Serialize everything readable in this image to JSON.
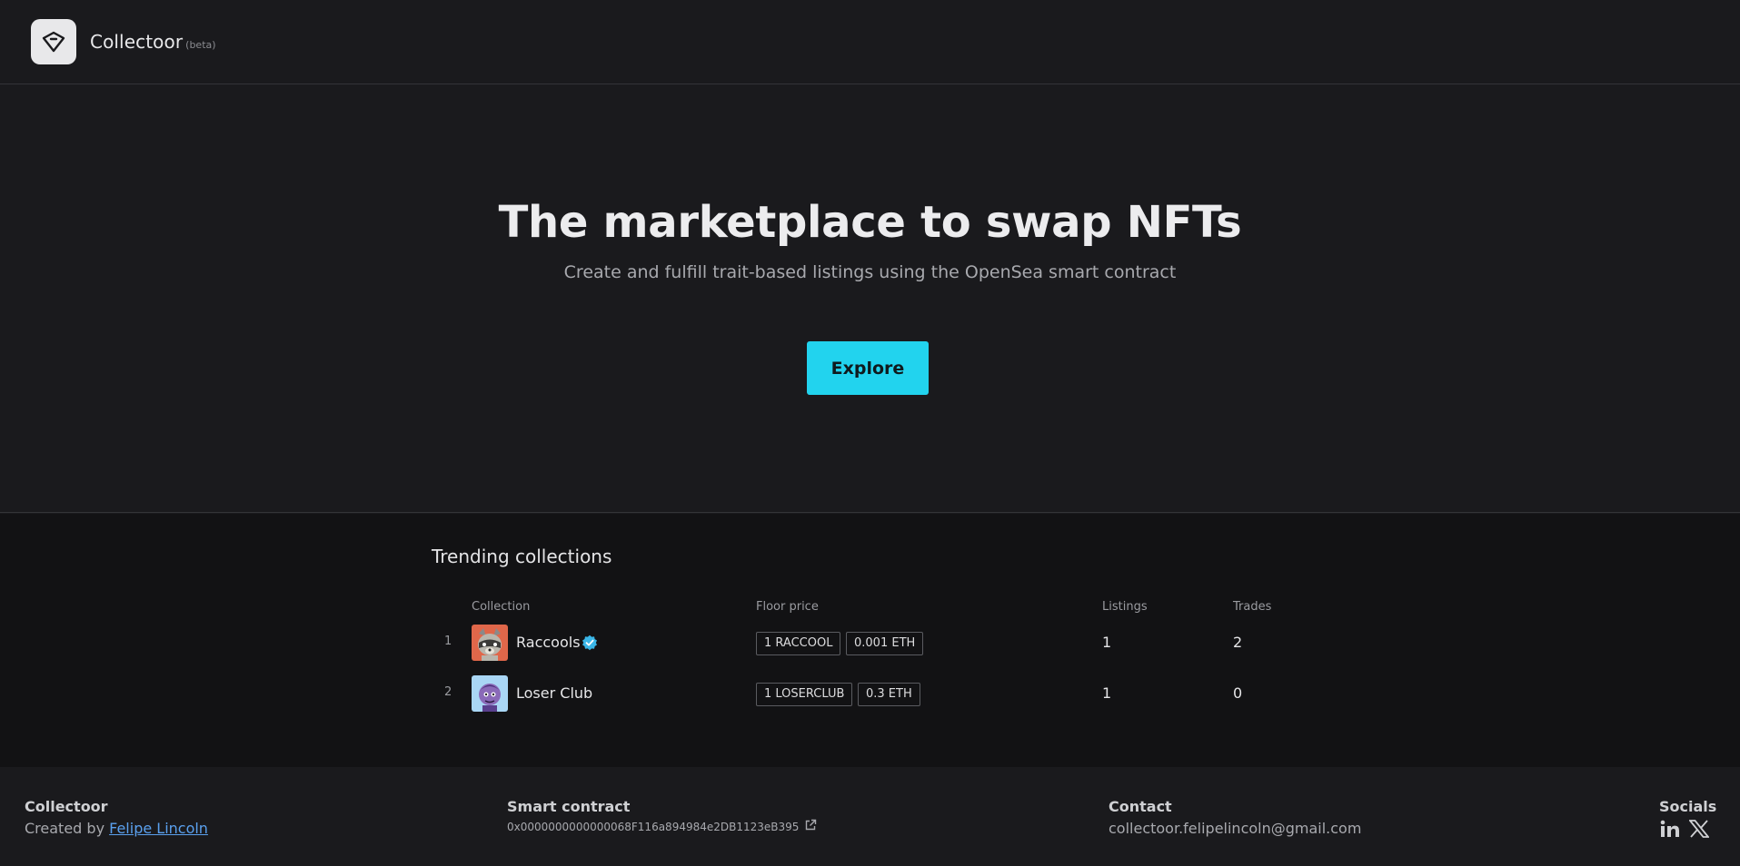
{
  "header": {
    "brand_name": "Collectoor",
    "beta_label": "(beta)"
  },
  "hero": {
    "title": "The marketplace to swap NFTs",
    "subtitle": "Create and fulfill trait-based listings using the OpenSea smart contract",
    "cta_label": "Explore"
  },
  "trending": {
    "title": "Trending collections",
    "columns": [
      "Collection",
      "Floor price",
      "Listings",
      "Trades"
    ],
    "rows": [
      {
        "rank": "1",
        "name": "Raccools",
        "verified": true,
        "floor_token": "1 RACCOOL",
        "floor_eth": "0.001 ETH",
        "listings": "1",
        "trades": "2"
      },
      {
        "rank": "2",
        "name": "Loser Club",
        "verified": false,
        "floor_token": "1 LOSERCLUB",
        "floor_eth": "0.3 ETH",
        "listings": "1",
        "trades": "0"
      }
    ]
  },
  "footer": {
    "brand_heading": "Collectoor",
    "created_by_prefix": "Created by ",
    "author_link": "Felipe Lincoln",
    "contract_heading": "Smart contract",
    "contract_address": "0x0000000000000068F116a894984e2DB1123eB395",
    "contact_heading": "Contact",
    "contact_email": "collectoor.felipelincoln@gmail.com",
    "socials_heading": "Socials"
  },
  "colors": {
    "accent": "#22d3ee",
    "background": "#1a1a1d",
    "section_background": "#121214",
    "link": "#5aa0ee",
    "verified": "#3ab6e8"
  },
  "icons": {
    "logo": "collectoor-logo-icon",
    "verified": "verified-badge-icon",
    "external": "external-link-icon",
    "linkedin": "linkedin-icon",
    "x": "x-twitter-icon"
  }
}
